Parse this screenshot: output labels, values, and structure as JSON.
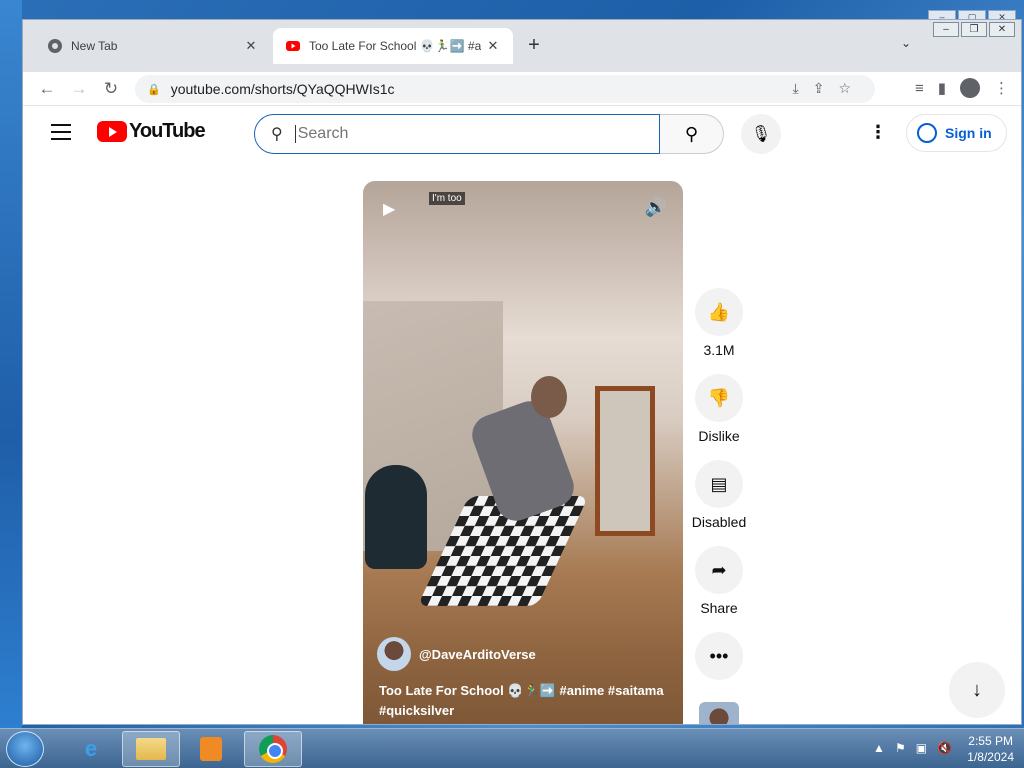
{
  "browser": {
    "tabs": [
      {
        "label": "New Tab",
        "icon": "chrome-icon",
        "active": false
      },
      {
        "label": "Too Late For School 💀🏃‍♂️➡️ #anime",
        "icon": "youtube-icon",
        "active": true
      }
    ],
    "new_tab_label": "+",
    "url": "youtube.com/shorts/QYaQQHWIs1c"
  },
  "youtube": {
    "logo_text": "YouTube",
    "search": {
      "placeholder": "Search",
      "value": ""
    },
    "signin_label": "Sign in",
    "short": {
      "overlay_caption": "I'm too",
      "channel": "@DaveArditoVerse",
      "title": "Too Late For School 💀🏃‍♂️➡️ #anime #saitama #quicksilver"
    },
    "actions": {
      "likes": "3.1M",
      "dislike_label": "Dislike",
      "comments_label": "Disabled",
      "share_label": "Share"
    }
  },
  "taskbar": {
    "clock_time": "2:55 PM",
    "clock_date": "1/8/2024"
  },
  "colors": {
    "yt_red": "#ff0000",
    "link_blue": "#065fd4",
    "search_focus": "#1c62b9"
  }
}
